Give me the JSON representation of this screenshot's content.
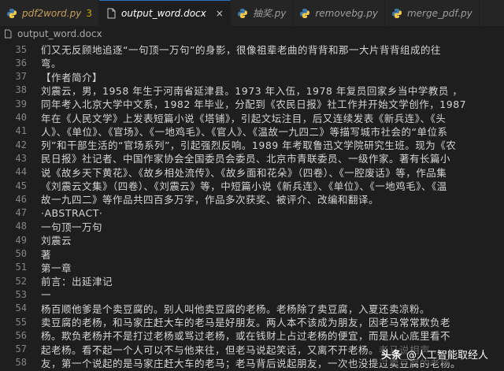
{
  "tabs": [
    {
      "label": "pdf2word.py",
      "badge": "3",
      "icon": "python-icon"
    },
    {
      "label": "output_word.docx",
      "close": "×",
      "icon": "file-icon"
    },
    {
      "label": "抽奖.py",
      "icon": "python-icon"
    },
    {
      "label": "removebg.py",
      "icon": "python-icon"
    },
    {
      "label": "merge_pdf.py",
      "icon": "python-icon"
    }
  ],
  "breadcrumb": {
    "file": "output_word.docx",
    "icon": "file-icon"
  },
  "lines": [
    {
      "n": "35",
      "text": "们又无反顾地追逐“一句顶一万句”的身影，很像祖辈老曲的背背和那一大片背背组成的往"
    },
    {
      "n": "36",
      "text": "弯。"
    },
    {
      "n": "37",
      "text": "【作者简介】"
    },
    {
      "n": "38",
      "text": "刘震云，男，1958 年生于河南省延津县。1973 年入伍，1978 年复员回家乡当中学教员 ，"
    },
    {
      "n": "39",
      "text": "同年考入北京大学中文系，1982 年毕业，分配到《农民日报》社工作并开始文学创作，1987"
    },
    {
      "n": "40",
      "text": "年在《人民文学》上发表短篇小说《塔铺》，引起文坛注目，后又连续发表《新兵连》、《头"
    },
    {
      "n": "41",
      "text": "人》、《单位》、《官场》、《一地鸡毛》、《官人》、《温故一九四二》等描写城市社会的“单位系"
    },
    {
      "n": "42",
      "text": "列”和干部生活的“官场系列”，引起强烈反响。1989 年考取鲁迅文学院研究生班。现为《农"
    },
    {
      "n": "43",
      "text": "民日报》社记者、中国作家协会全国委员会委员、北京市青联委员、一级作家。著有长篇小"
    },
    {
      "n": "44",
      "text": "说《故乡天下黄花》、《故乡相处流传》、《故乡面和花朵》（四卷）、《一腔废话》等，作品集"
    },
    {
      "n": "45",
      "text": "《刘震云文集》（四卷）、《刘震云》等，中短篇小说《新兵连》、《单位》、《一地鸡毛》、《温"
    },
    {
      "n": "46",
      "text": "故一九四二》等作品共四百多万字，作品多次获奖、被评介、改编和翻译。"
    },
    {
      "n": "47",
      "text": "·ABSTRACT·"
    },
    {
      "n": "48",
      "text": "一句顶一万句"
    },
    {
      "n": "49",
      "text": "刘震云"
    },
    {
      "n": "50",
      "text": "著"
    },
    {
      "n": "51",
      "text": "第一章"
    },
    {
      "n": "52",
      "text": "前言：出延津记"
    },
    {
      "n": "53",
      "text": "一"
    },
    {
      "n": "54",
      "text": "杨百顺他爹是个卖豆腐的。别人叫他卖豆腐的老杨。老杨除了卖豆腐，入夏还卖凉粉。"
    },
    {
      "n": "55",
      "text": "卖豆腐的老杨，和马家庄赶大车的老马是好朋友。两人本不该成为朋友，因老马常常欺负老"
    },
    {
      "n": "56",
      "text": "杨。欺负老杨并不是打过老杨或骂过老杨，或在钱财上占过老杨的便宜，而是从心底里看不"
    },
    {
      "n": "57",
      "text": "起老杨。看不起一个人可以不与他来往，但老马说起笑话，又离不开老杨。老马说相声……"
    },
    {
      "n": "58",
      "text": "友，第一个说起的是马家庄赶大车的老马；老马背后说起朋友，一次也没提过卖豆腐的老杨。"
    }
  ],
  "watermark": {
    "logo": "头条",
    "text": "@人工智能取经人"
  },
  "colors": {
    "background": "#1e1e1e",
    "tabbar": "#252526",
    "line_number": "#858585",
    "text": "#d4d4d4",
    "badge": "#cca700"
  }
}
